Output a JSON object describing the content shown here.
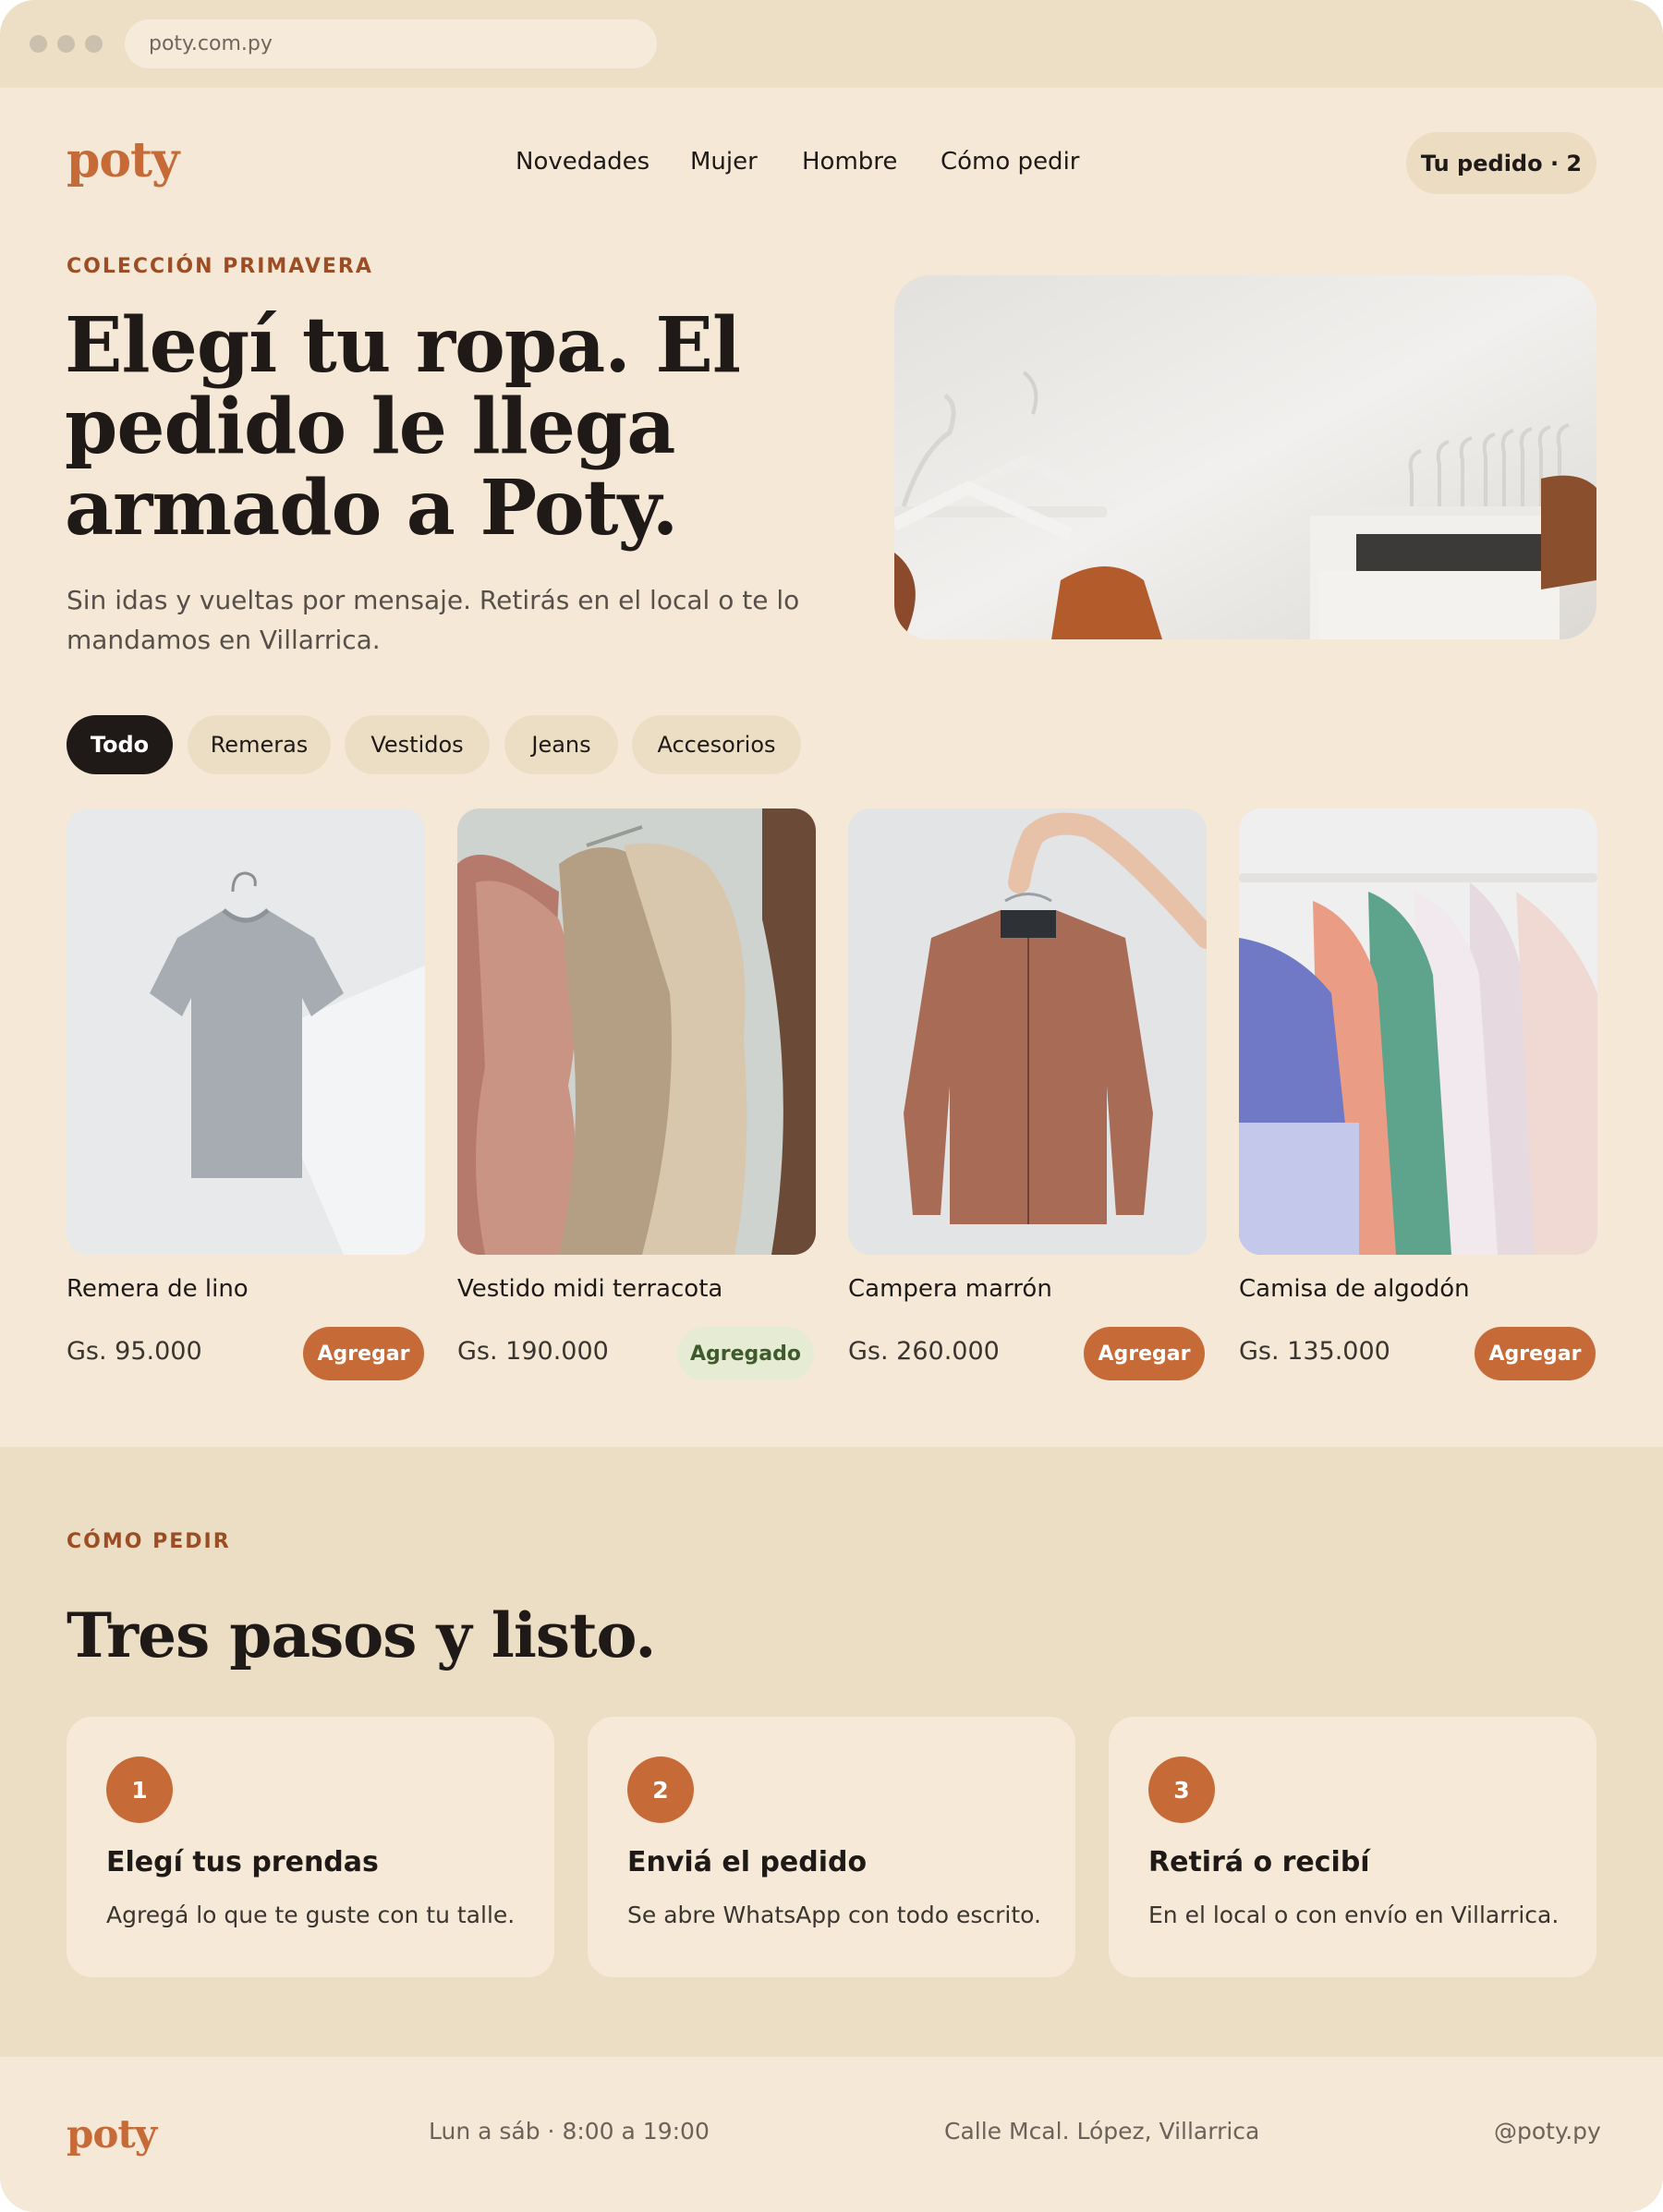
{
  "browser": {
    "url": "poty.com.py"
  },
  "header": {
    "logo": "poty",
    "nav": [
      "Novedades",
      "Mujer",
      "Hombre",
      "Cómo pedir"
    ],
    "order_button": "Tu pedido · 2"
  },
  "hero": {
    "eyebrow": "COLECCIÓN PRIMAVERA",
    "title": "Elegí tu ropa. El pedido le llega armado a Poty.",
    "subtitle": "Sin idas y vueltas por mensaje. Retirás en el local o te lo mandamos en Villarrica."
  },
  "filters": [
    {
      "label": "Todo",
      "active": true
    },
    {
      "label": "Remeras",
      "active": false
    },
    {
      "label": "Vestidos",
      "active": false
    },
    {
      "label": "Jeans",
      "active": false
    },
    {
      "label": "Accesorios",
      "active": false
    }
  ],
  "products": [
    {
      "name": "Remera de lino",
      "price": "Gs. 95.000",
      "button": "Agregar",
      "added": false
    },
    {
      "name": "Vestido midi terracota",
      "price": "Gs. 190.000",
      "button": "Agregado",
      "added": true
    },
    {
      "name": "Campera marrón",
      "price": "Gs. 260.000",
      "button": "Agregar",
      "added": false
    },
    {
      "name": "Camisa de algodón",
      "price": "Gs. 135.000",
      "button": "Agregar",
      "added": false
    }
  ],
  "how_to": {
    "eyebrow": "CÓMO PEDIR",
    "title": "Tres pasos y listo.",
    "steps": [
      {
        "number": "1",
        "title": "Elegí tus prendas",
        "text": "Agregá lo que te guste con tu talle."
      },
      {
        "number": "2",
        "title": "Enviá el pedido",
        "text": "Se abre WhatsApp con todo escrito."
      },
      {
        "number": "3",
        "title": "Retirá o recibí",
        "text": "En el local o con envío en Villarrica."
      }
    ]
  },
  "footer": {
    "logo": "poty",
    "hours": "Lun a sáb · 8:00 a 19:00",
    "address": "Calle Mcal. López, Villarrica",
    "handle": "@poty.py"
  },
  "colors": {
    "accent": "#c66b38",
    "background": "#f5e8d7",
    "band": "#ecdec4",
    "ink": "#1f1a17",
    "added": "#e6ecd3"
  }
}
